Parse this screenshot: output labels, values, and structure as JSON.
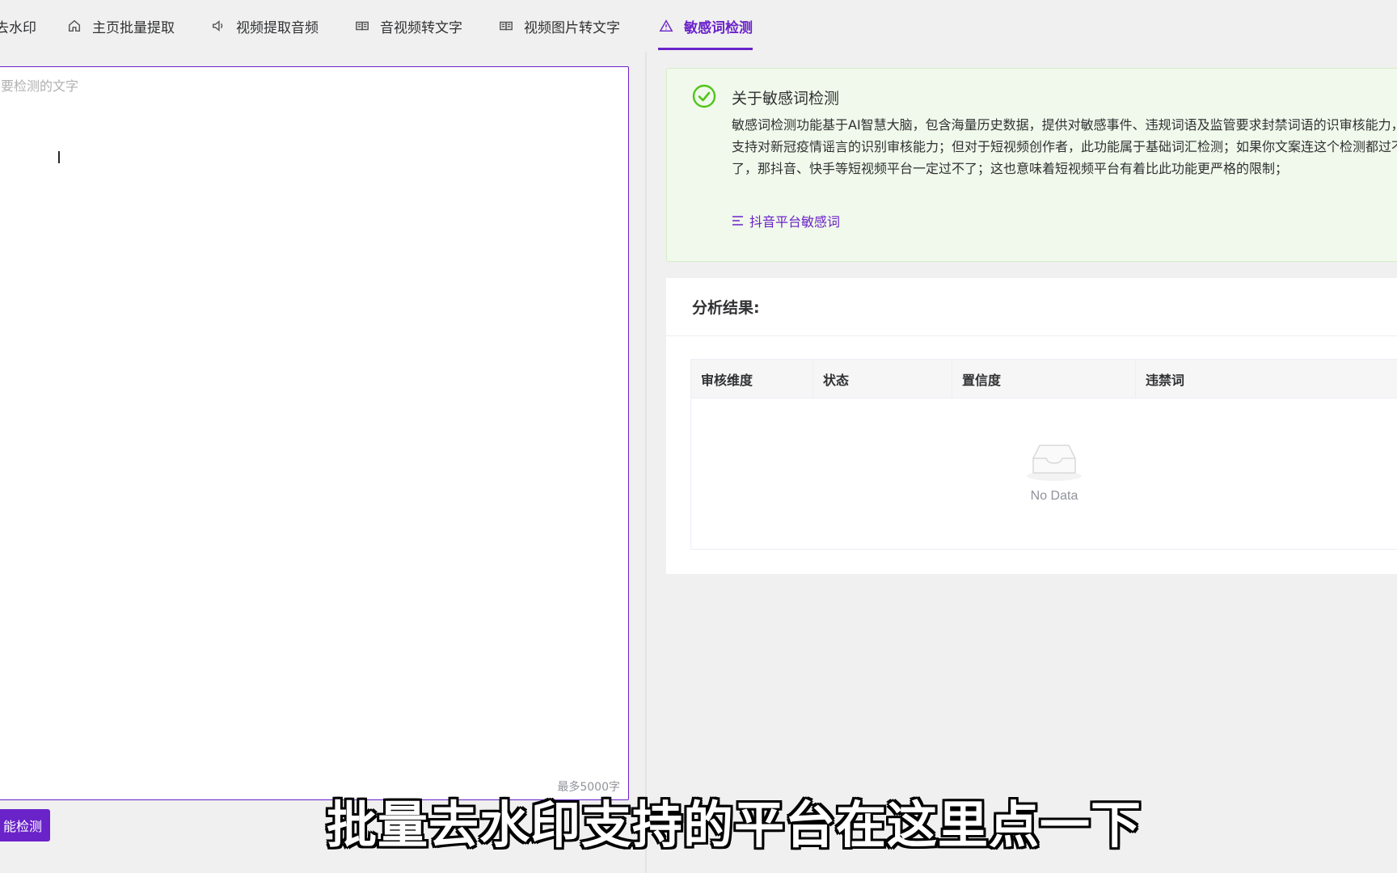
{
  "tabs": [
    {
      "label": "去水印",
      "icon": "none"
    },
    {
      "label": "主页批量提取",
      "icon": "home-icon"
    },
    {
      "label": "视频提取音频",
      "icon": "speaker-icon"
    },
    {
      "label": "音视频转文字",
      "icon": "book-icon"
    },
    {
      "label": "视频图片转文字",
      "icon": "book-icon"
    },
    {
      "label": "敏感词检测",
      "icon": "warning-icon",
      "active": true
    }
  ],
  "editor": {
    "placeholder": "要检测的文字",
    "counter": "最多5000字"
  },
  "detect_button": "能检测",
  "alert": {
    "title": "关于敏感词检测",
    "body": "敏感词检测功能基于AI智慧大脑，包含海量历史数据，提供对敏感事件、违规词语及监管要求封禁词语的识审核能力，支持对新冠疫情谣言的识别审核能力；但对于短视频创作者，此功能属于基础词汇检测；如果你文案连这个检测都过不了，那抖音、快手等短视频平台一定过不了；这也意味着短视频平台有着比此功能更严格的限制；",
    "link": "抖音平台敏感词"
  },
  "result": {
    "title": "分析结果:",
    "columns": [
      "审核维度",
      "状态",
      "置信度",
      "违禁词"
    ],
    "empty_text": "No Data"
  },
  "subtitle": "批量去水印支持的平台在这里点一下",
  "colors": {
    "accent": "#6a22c9",
    "alert_bg": "#f0f9eb",
    "success": "#52c41a"
  }
}
